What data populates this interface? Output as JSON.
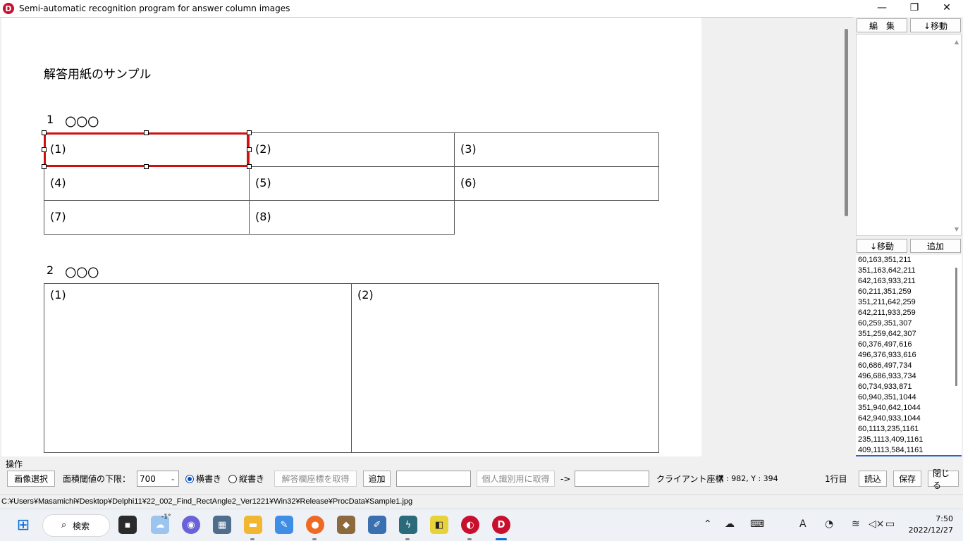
{
  "window": {
    "title": "Semi-automatic recognition program for answer column images",
    "app_icon_letter": "D",
    "minimize": "—",
    "restore": "❐",
    "close": "✕"
  },
  "page": {
    "heading": "解答用紙のサンプル",
    "sections": [
      {
        "number": "1",
        "title": "〇〇〇"
      },
      {
        "number": "2",
        "title": "〇〇〇"
      }
    ],
    "cells": [
      "(1)",
      "(2)",
      "(3)",
      "(4)",
      "(5)",
      "(6)",
      "(7)",
      "(8)",
      "(1)",
      "(2)"
    ]
  },
  "right_panel": {
    "edit_button": "編　集",
    "move_down_button_top": "↓移動",
    "move_down_button_bottom": "↓移動",
    "add_button": "追加",
    "coords": [
      "60,163,351,211",
      "351,163,642,211",
      "642,163,933,211",
      "60,211,351,259",
      "351,211,642,259",
      "642,211,933,259",
      "60,259,351,307",
      "351,259,642,307",
      "60,376,497,616",
      "496,376,933,616",
      "60,686,497,734",
      "496,686,933,734",
      "60,734,933,871",
      "60,940,351,1044",
      "351,940,642,1044",
      "642,940,933,1044",
      "60,1113,235,1161",
      "235,1113,409,1161",
      "409,1113,584,1161"
    ]
  },
  "ops": {
    "group_label": "操作",
    "select_image_button": "画像選択",
    "area_threshold_label": "面積閾値の下限：",
    "area_threshold_value": "700",
    "horizontal_label": "横書き",
    "vertical_label": "縦書き",
    "get_answer_coords_button": "解答欄座標を取得",
    "add_button": "追加",
    "add_input_value": "",
    "get_personal_id_button": "個人識別用に取得",
    "arrow_label": "->",
    "personal_id_input_value": "",
    "client_coords_label": "クライアント座標",
    "client_coords_value": "X : 982, Y : 394",
    "row_indicator": "1行目",
    "load_button": "読込",
    "save_button": "保存",
    "close_button": "閉じる"
  },
  "status": {
    "path": "C:¥Users¥Masamichi¥Desktop¥Delphi11¥22_002_Find_RectAngle2_Ver1221¥Win32¥Release¥ProcData¥Sample1.jpg"
  },
  "taskbar": {
    "search_label": "検索",
    "weather_temp": "-1°",
    "time": "7:50",
    "date": "2022/12/27",
    "ime_label": "A"
  },
  "colors": {
    "selection": "#d01010",
    "accent": "#0a4fc0"
  }
}
